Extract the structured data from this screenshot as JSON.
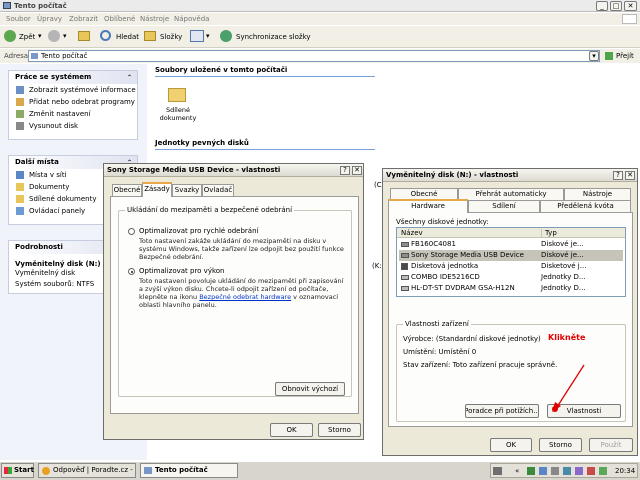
{
  "window": {
    "title": "Tento počítač"
  },
  "menu": [
    "Soubor",
    "Úpravy",
    "Zobrazit",
    "Oblíbené",
    "Nástroje",
    "Nápověda"
  ],
  "toolbar": {
    "back": "Zpět",
    "search": "Hledat",
    "folders": "Složky",
    "sync": "Synchronizace složky"
  },
  "address": {
    "label": "Adresa",
    "value": "Tento počítač",
    "go": "Přejít"
  },
  "sidebar": {
    "system": {
      "title": "Práce se systémem",
      "items": [
        "Zobrazit systémové informace",
        "Přidat nebo odebrat programy",
        "Změnit nastavení",
        "Vysunout disk"
      ]
    },
    "places": {
      "title": "Další místa",
      "items": [
        "Místa v síti",
        "Dokumenty",
        "Sdílené dokumenty",
        "Ovládací panely"
      ]
    },
    "details": {
      "title": "Podrobnosti",
      "name": "Vyměnitelný disk (N:)",
      "type": "Vyměnitelný disk",
      "fs": "Systém souborů: NTFS"
    }
  },
  "content": {
    "section1": "Soubory uložené v tomto počítači",
    "shared_docs": "Sdílené dokumenty",
    "section2": "Jednotky pevných disků",
    "cut1": "(C",
    "cut2": "(K:"
  },
  "dlg1": {
    "title": "Sony Storage Media USB Device - vlastnosti",
    "tabs": [
      "Obecné",
      "Zásady",
      "Svazky",
      "Ovladač"
    ],
    "group": "Ukládání do mezipaměti a bezpečené odebrání",
    "opt1": {
      "label": "Optimalizovat pro rychlé odebrání",
      "desc": "Toto nastavení zakáže ukládání do mezipaměti na disku v systému Windows, takže zařízení lze odpojit bez použití funkce Bezpečné odebrání."
    },
    "opt2": {
      "label": "Optimalizovat pro výkon",
      "desc1": "Toto nastavení povoluje ukládání do mezipaměti při zapisování a zvýší výkon disku. Chcete-li odpojit zařízení od počítače, klepněte na ikonu ",
      "link": "Bezpečné odebrat hardware",
      "desc2": " v oznamovací oblasti hlavního panelu."
    },
    "restore": "Obnovit výchozí",
    "ok": "OK",
    "cancel": "Storno"
  },
  "dlg2": {
    "title": "Vyměnitelný disk (N:) - vlastnosti",
    "tabs_row1": [
      "Obecné",
      "Přehrát automaticky",
      "Nástroje"
    ],
    "tabs_row2": [
      "Hardware",
      "Sdílení",
      "Předělená kvóta"
    ],
    "list_label": "Všechny diskové jednotky:",
    "col_name": "Název",
    "col_type": "Typ",
    "rows": [
      {
        "name": "FB160C4081",
        "type": "Diskové je..."
      },
      {
        "name": "Sony Storage Media USB Device",
        "type": "Diskové je..."
      },
      {
        "name": "Disketová jednotka",
        "type": "Disketové j..."
      },
      {
        "name": "COMBO IDE5216CD",
        "type": "Jednotky D..."
      },
      {
        "name": "HL-DT-ST DVDRAM GSA-H12N",
        "type": "Jednotky D..."
      }
    ],
    "props_title": "Vlastnosti zařízení",
    "manufacturer": "Výrobce: (Standardní diskové jednotky)",
    "location": "Umístění: Umístění 0",
    "status": "Stav zařízení: Toto zařízení pracuje správně.",
    "troubleshoot": "Poradce při potížích...",
    "properties": "Vlastnosti",
    "annotation": "Klikněte",
    "ok": "OK",
    "cancel": "Storno",
    "apply": "Použít"
  },
  "taskbar": {
    "start": "Start",
    "task1": "Odpověď | Poradte.cz - ...",
    "task2": "Tento počítač",
    "clock": "20:34"
  },
  "colors": {
    "annotation": "#e00000",
    "selected_row": "#c6c3b8",
    "link": "#0033cc"
  }
}
